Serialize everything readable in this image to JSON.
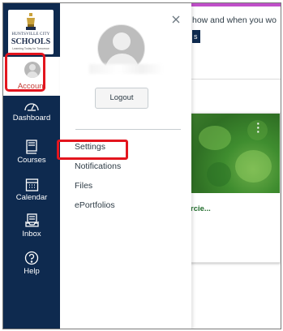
{
  "logo": {
    "line1": "HUNTSVILLE CITY",
    "line2": "SCHOOLS",
    "tagline": "Learning Today for Tomorrow"
  },
  "global_nav": {
    "account": {
      "label": "Account",
      "icon": "user-avatar-icon"
    },
    "items": [
      {
        "label": "Dashboard",
        "icon": "dashboard-gauge-icon"
      },
      {
        "label": "Courses",
        "icon": "book-icon"
      },
      {
        "label": "Calendar",
        "icon": "calendar-icon"
      },
      {
        "label": "Inbox",
        "icon": "inbox-icon"
      },
      {
        "label": "Help",
        "icon": "help-circle-icon"
      }
    ]
  },
  "account_tray": {
    "close_icon": "close-x-icon",
    "logout_label": "Logout",
    "links": [
      {
        "label": "Settings"
      },
      {
        "label": "Notifications"
      },
      {
        "label": "Files"
      },
      {
        "label": "ePortfolios"
      }
    ]
  },
  "background_page": {
    "banner_text": "how and when you wo",
    "banner_button_text": "s",
    "course_card": {
      "title": "rcie...",
      "menu_icon": "vertical-dots-icon"
    }
  },
  "colors": {
    "nav_background": "#0e2a4f",
    "highlight": "#e3151e",
    "account_active": "#c23b33",
    "top_accent": "#c04fc9",
    "course_green": "#3f8d2f"
  }
}
